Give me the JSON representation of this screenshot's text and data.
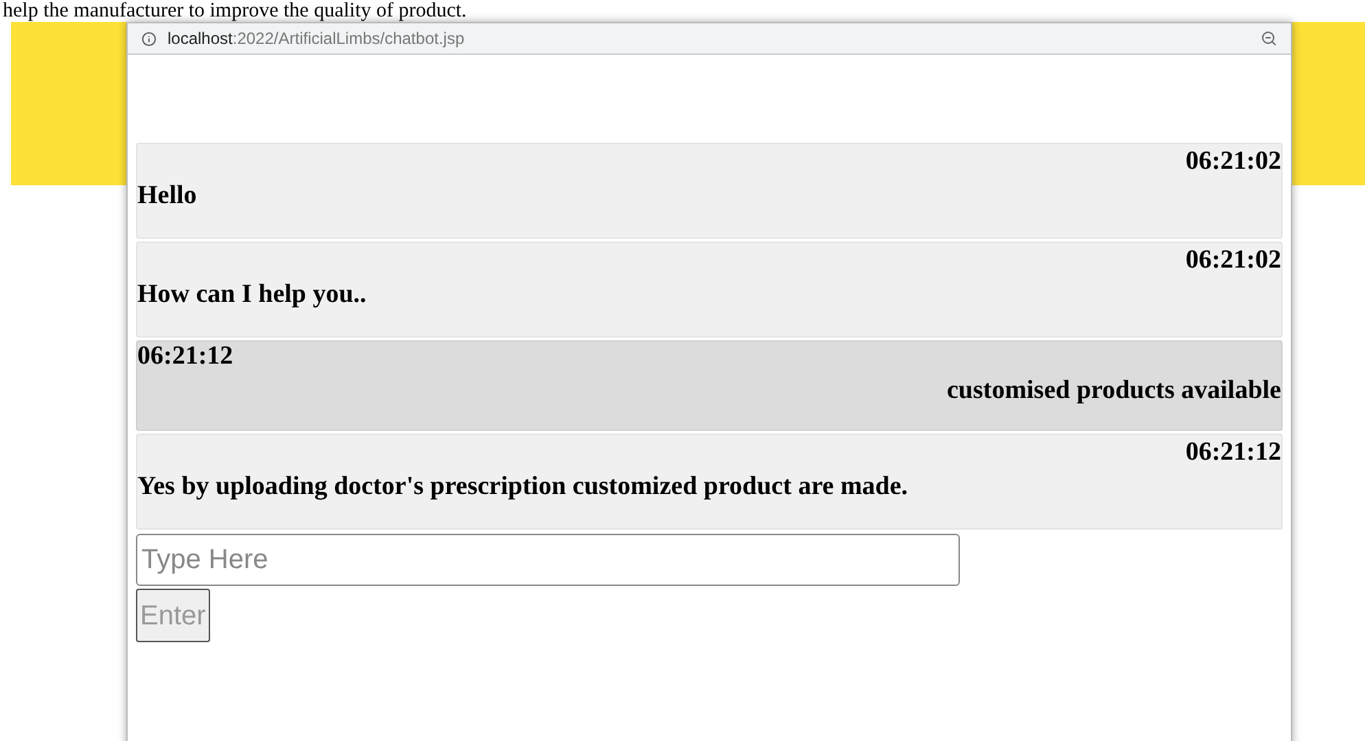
{
  "page_text": "help the manufacturer to improve the quality of product.",
  "popup": {
    "url_host": "localhost",
    "url_path": ":2022/ArtificialLimbs/chatbot.jsp"
  },
  "messages": [
    {
      "kind": "bot",
      "time": "06:21:02",
      "text": "Hello"
    },
    {
      "kind": "bot",
      "time": "06:21:02",
      "text": "How can I help you.."
    },
    {
      "kind": "user",
      "time": "06:21:12",
      "text": "customised products available"
    },
    {
      "kind": "bot",
      "time": "06:21:12",
      "text": "Yes by uploading doctor's prescription customized product are made."
    }
  ],
  "input": {
    "placeholder": "Type Here"
  },
  "button": {
    "label": "Enter",
    "disabled": true
  }
}
